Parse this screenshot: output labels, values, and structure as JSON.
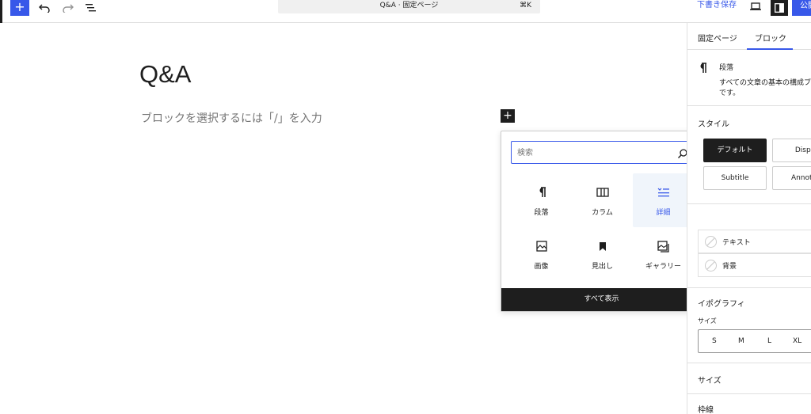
{
  "toolbar": {
    "add_label": "+",
    "command_title": "Q&A · 固定ページ",
    "command_shortcut": "⌘K",
    "save_draft": "下書き保存",
    "publish": "公開",
    "icons": [
      "undo-icon",
      "redo-icon",
      "list-view-icon",
      "preview-icon",
      "settings-icon"
    ]
  },
  "editor": {
    "title": "Q&A",
    "placeholder": "ブロックを選択するには「/」を入力",
    "inserter_label": "+"
  },
  "inserter": {
    "search_placeholder": "検索",
    "blocks": [
      {
        "label": "段落",
        "icon": "paragraph-icon"
      },
      {
        "label": "カラム",
        "icon": "columns-icon"
      },
      {
        "label": "詳細",
        "icon": "details-icon",
        "selected": true
      },
      {
        "label": "画像",
        "icon": "image-icon"
      },
      {
        "label": "見出し",
        "icon": "heading-icon"
      },
      {
        "label": "ギャラリー",
        "icon": "gallery-icon"
      }
    ],
    "browse_all": "すべて表示"
  },
  "sidebar": {
    "tabs": [
      "固定ページ",
      "ブロック"
    ],
    "active_tab": "ブロック",
    "block": {
      "name": "段落",
      "description_line1": "すべての文章の基本の構成ブ",
      "description_line2": "です。"
    },
    "styles": {
      "title": "スタイル",
      "options": [
        "デフォルト",
        "Displ",
        "Subtitle",
        "Annota"
      ],
      "selected": "デフォルト"
    },
    "color": {
      "items": [
        "テキスト",
        "背景"
      ]
    },
    "typography": {
      "title": "イポグラフィ",
      "size_label": "サイズ",
      "sizes": [
        "S",
        "M",
        "L",
        "XL"
      ]
    },
    "dimensions_title": "サイズ",
    "border_title": "枠線"
  },
  "colors": {
    "accent": "#3858e9",
    "dark": "#1e1e1e",
    "border": "#e0e0e0",
    "muted": "#757575"
  }
}
